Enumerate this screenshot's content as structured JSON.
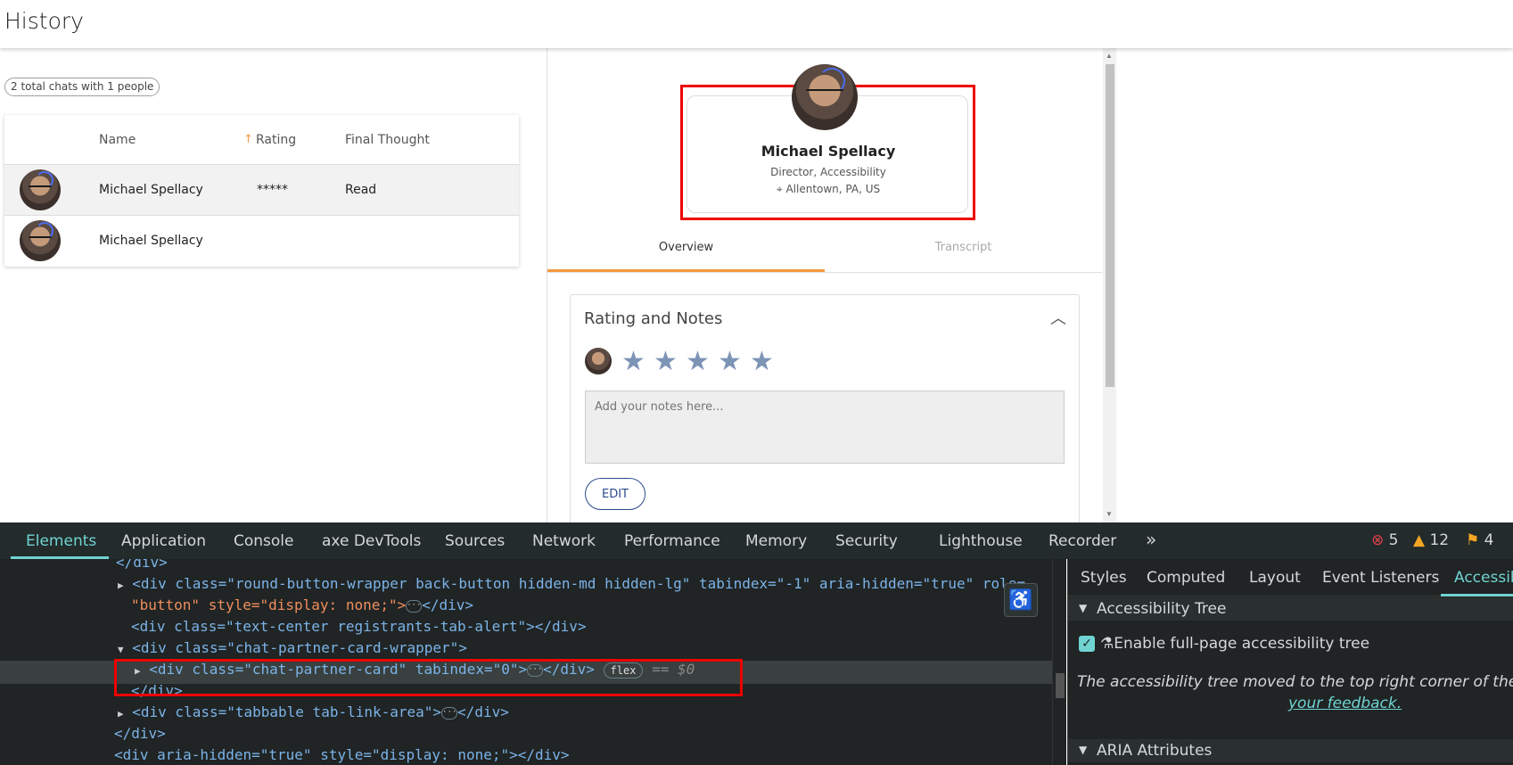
{
  "header": {
    "title": "History"
  },
  "summary": {
    "pill": "2 total chats with 1 people"
  },
  "table": {
    "columns": {
      "name": "Name",
      "rating": "Rating",
      "final": "Final Thought"
    },
    "rows": [
      {
        "name": "Michael Spellacy",
        "rating": "*****",
        "final": "Read"
      },
      {
        "name": "Michael Spellacy",
        "rating": "",
        "final": ""
      }
    ]
  },
  "partner": {
    "name": "Michael Spellacy",
    "role": "Director, Accessibility",
    "location": "Allentown, PA, US"
  },
  "detail_tabs": {
    "overview": "Overview",
    "transcript": "Transcript"
  },
  "notes": {
    "title": "Rating and Notes",
    "placeholder": "Add your notes here...",
    "edit_label": "EDIT"
  },
  "devtools": {
    "tabs": [
      "Elements",
      "Application",
      "Console",
      "axe DevTools",
      "Sources",
      "Network",
      "Performance",
      "Memory",
      "Security",
      "Lighthouse",
      "Recorder"
    ],
    "more": "»",
    "errors": "5",
    "warnings": "12",
    "issues": "4",
    "code": {
      "l0": "</div>",
      "l1a": "<div class=\"round-button-wrapper back-button hidden-md hidden-lg\" tabindex=\"-1\" aria-hidden=\"true\" role=",
      "l1b": "\"button\" style=\"display: none;\">",
      "l1c": "</div>",
      "l2": "<div class=\"text-center registrants-tab-alert\"></div>",
      "l3": "<div class=\"chat-partner-card-wrapper\">",
      "l4a": "<div class=\"chat-partner-card\" tabindex=\"0\">",
      "l4b": "</div>",
      "l4badge": "flex",
      "l4ref": "== $0",
      "l5": "</div>",
      "l6a": "<div class=\"tabbable tab-link-area\">",
      "l6b": "</div>",
      "l7": "</div>",
      "l8": "<div aria-hidden=\"true\" style=\"display: none;\"></div>"
    },
    "side_tabs": [
      "Styles",
      "Computed",
      "Layout",
      "Event Listeners",
      "Accessib"
    ],
    "a11y_tree_title": "Accessibility Tree",
    "enable_label": "Enable full-page accessibility tree",
    "moved_note": "The accessibility tree moved to the top right corner of the DOM",
    "feedback_link": "your feedback.",
    "aria_title": "ARIA Attributes"
  },
  "colors": {
    "accent_orange": "#f59a3c",
    "devtools_teal": "#6fd4d2",
    "star": "#7e94b5",
    "highlight_red": "#ee0000"
  }
}
